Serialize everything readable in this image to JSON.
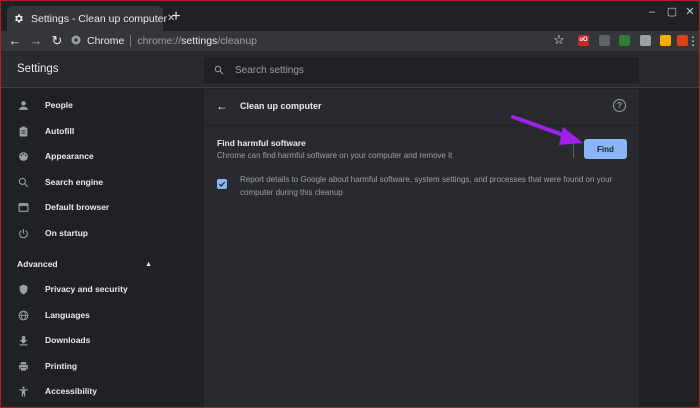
{
  "window": {
    "tab_title": "Settings - Clean up computer",
    "new_tab_label": "+"
  },
  "toolbar": {
    "site_name": "Chrome",
    "url_prefix": "chrome://",
    "url_path": "settings",
    "url_suffix": "/cleanup",
    "extensions": [
      {
        "name": "ublock-icon",
        "label": "uO",
        "color": "#c62828"
      },
      {
        "name": "extension-gray-icon",
        "label": "",
        "color": "#5f6368"
      },
      {
        "name": "evernote-icon",
        "label": "",
        "color": "#2e7d32"
      },
      {
        "name": "extension-doc-icon",
        "label": "",
        "color": "#9aa0a6"
      },
      {
        "name": "extension-color-icon",
        "label": "",
        "color": "#f9ab00"
      },
      {
        "name": "office-icon",
        "label": "",
        "color": "#d84315"
      }
    ]
  },
  "header": {
    "title": "Settings",
    "search_placeholder": "Search settings"
  },
  "sidebar": {
    "items": [
      {
        "label": "People",
        "icon": "person-icon"
      },
      {
        "label": "Autofill",
        "icon": "clipboard-icon"
      },
      {
        "label": "Appearance",
        "icon": "palette-icon"
      },
      {
        "label": "Search engine",
        "icon": "search-icon"
      },
      {
        "label": "Default browser",
        "icon": "browser-icon"
      },
      {
        "label": "On startup",
        "icon": "power-icon"
      }
    ],
    "advanced_label": "Advanced",
    "advanced_items": [
      {
        "label": "Privacy and security",
        "icon": "shield-icon"
      },
      {
        "label": "Languages",
        "icon": "globe-icon"
      },
      {
        "label": "Downloads",
        "icon": "download-icon"
      },
      {
        "label": "Printing",
        "icon": "printer-icon"
      },
      {
        "label": "Accessibility",
        "icon": "accessibility-icon"
      }
    ]
  },
  "cleanup": {
    "title": "Clean up computer",
    "find_title": "Find harmful software",
    "find_desc": "Chrome can find harmful software on your computer and remove it",
    "find_button": "Find",
    "report_checked": true,
    "report_text": "Report details to Google about harmful software, system settings, and processes that were found on your computer during this cleanup"
  },
  "colors": {
    "accent": "#8ab4f8",
    "annotation_arrow": "#a020f0",
    "frame": "#b0202a"
  }
}
